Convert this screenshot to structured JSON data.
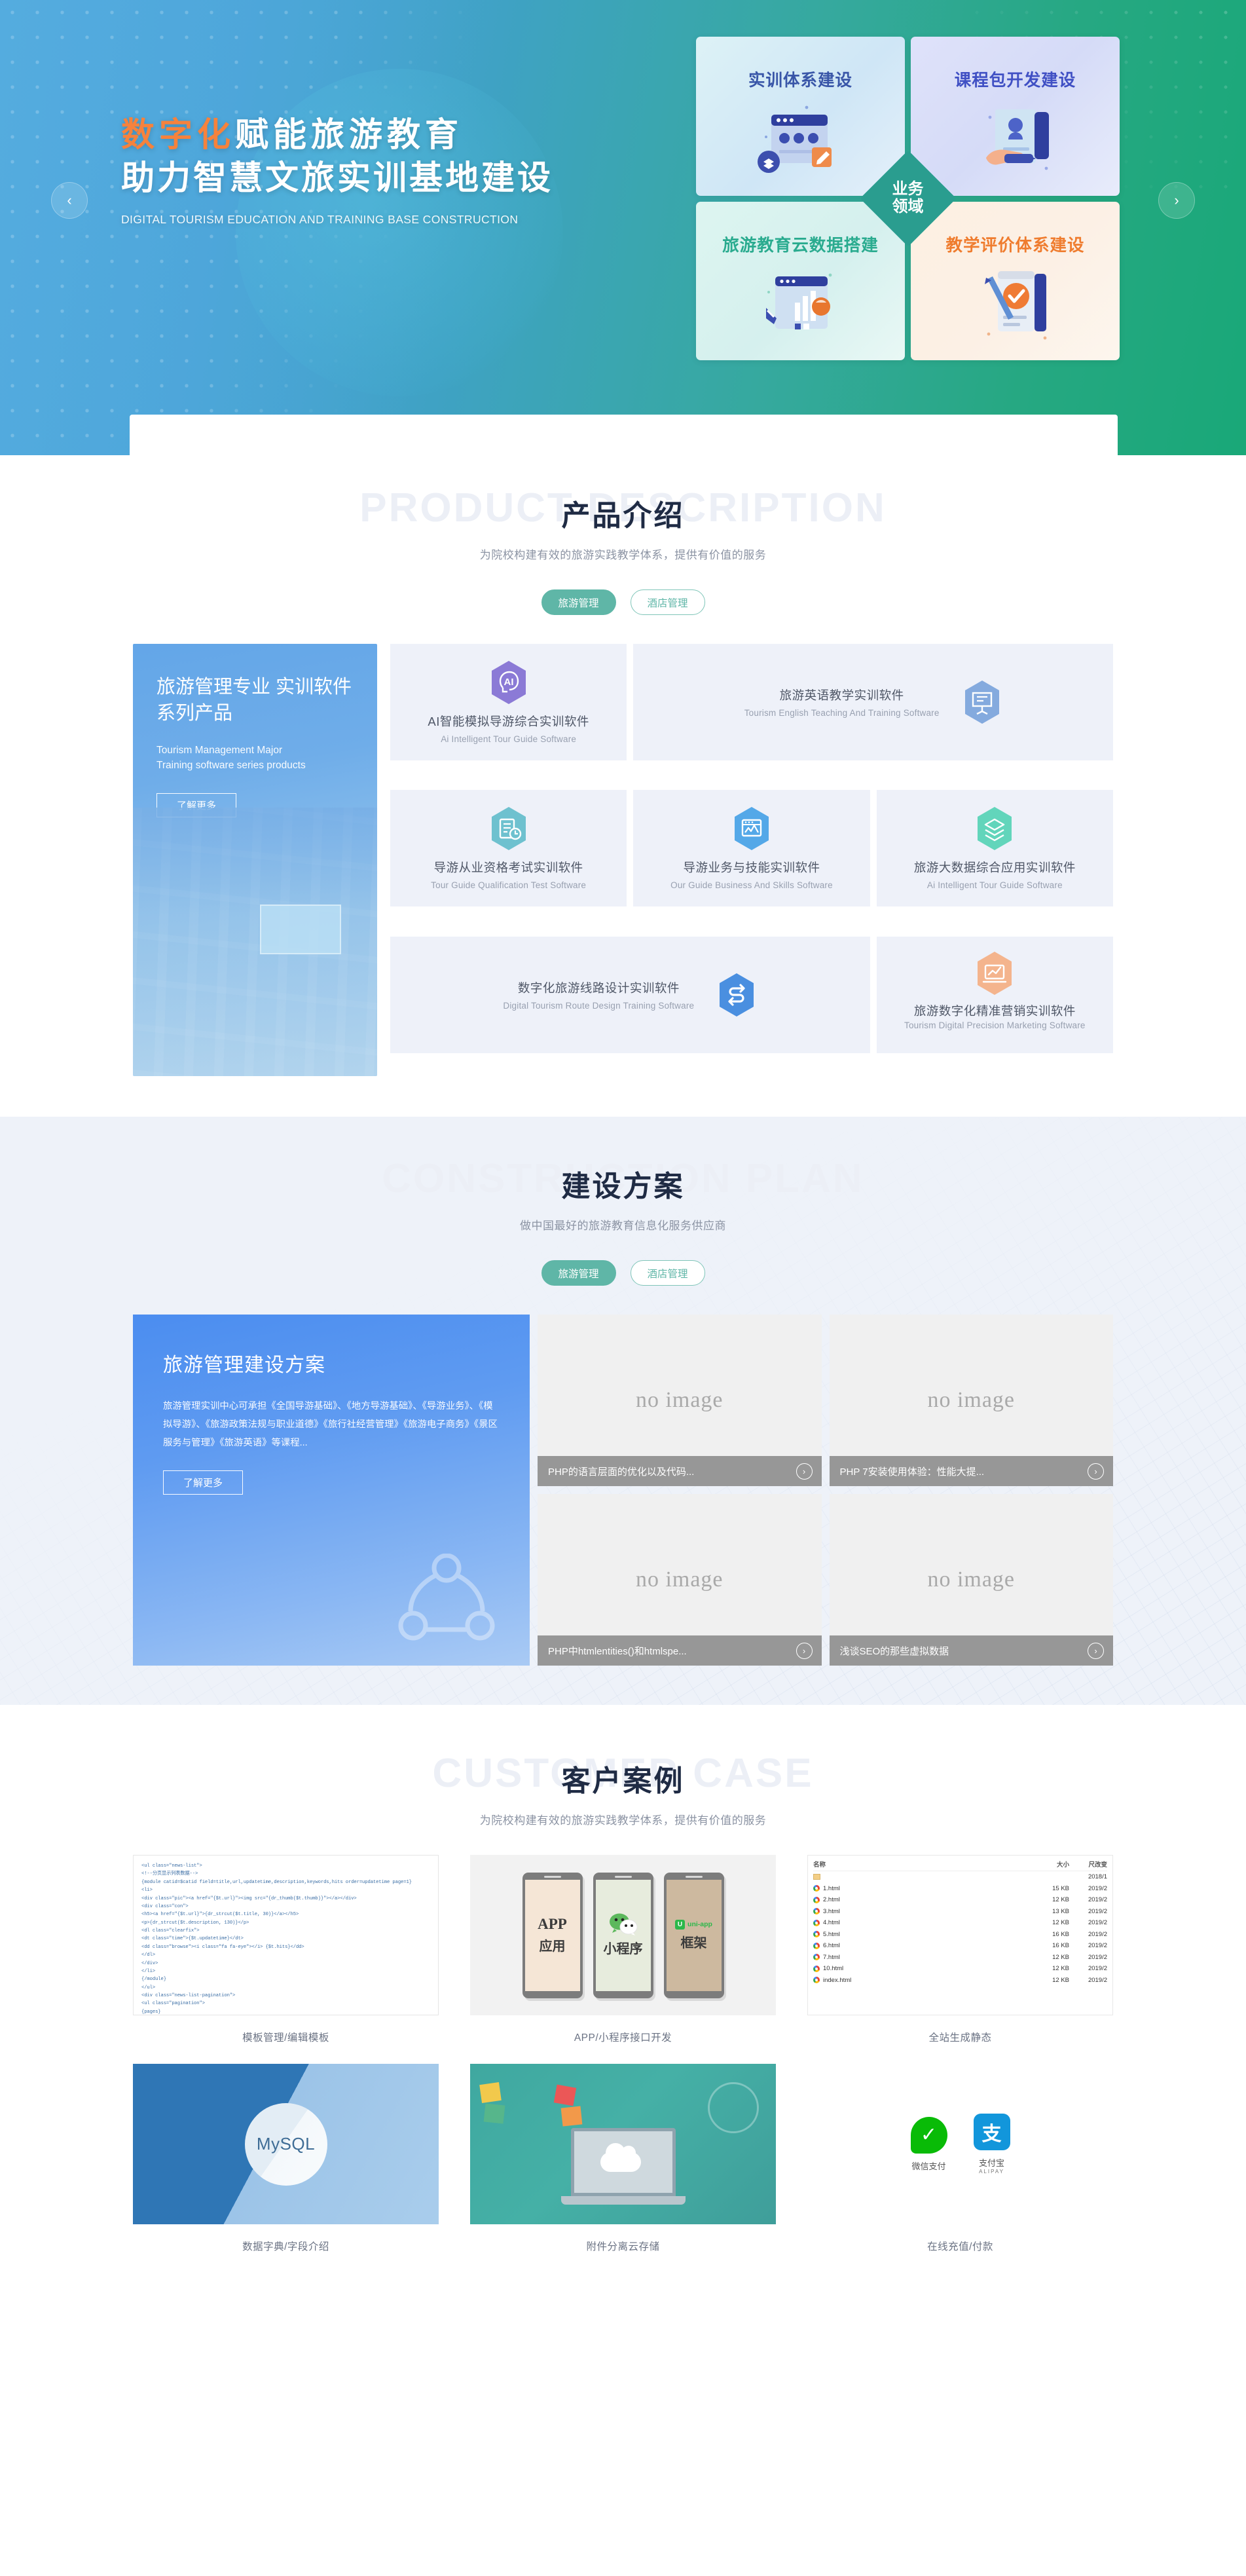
{
  "hero": {
    "title_accent": "数字化",
    "title_rest": "赋能旅游教育",
    "title_line2": "助力智慧文旅实训基地建设",
    "subtitle_en": "DIGITAL TOURISM EDUCATION AND TRAINING BASE CONSTRUCTION",
    "prev_arrow": "‹",
    "next_arrow": "›",
    "badge_line1": "业务",
    "badge_line2": "领域",
    "cards": [
      {
        "label": "实训体系建设"
      },
      {
        "label": "课程包开发建设"
      },
      {
        "label": "旅游教育云数据搭建"
      },
      {
        "label": "教学评价体系建设"
      }
    ]
  },
  "product_section": {
    "ghost": "PRODUCT DESCRIPTION",
    "title": "产品介绍",
    "subtitle": "为院校构建有效的旅游实践教学体系，提供有价值的服务",
    "tabs": [
      {
        "label": "旅游管理",
        "active": true
      },
      {
        "label": "酒店管理",
        "active": false
      }
    ],
    "promo": {
      "title": "旅游管理专业 实训软件系列产品",
      "en_line1": "Tourism Management Major",
      "en_line2": "Training software series products",
      "button": "了解更多"
    },
    "items": [
      {
        "cn": "AI智能模拟导游综合实训软件",
        "en": "Ai Intelligent Tour Guide Software",
        "icon": "ai-head-icon",
        "color": "#8b7ad6"
      },
      {
        "cn": "旅游英语教学实训软件",
        "en": "Tourism English Teaching And Training Software",
        "icon": "presentation-board-icon",
        "color": "#84aade"
      },
      {
        "cn": "导游从业资格考试实训软件",
        "en": "Tour Guide Qualification Test Software",
        "icon": "document-clock-icon",
        "color": "#6ec1cf"
      },
      {
        "cn": "导游业务与技能实训软件",
        "en": "Our Guide Business And Skills Software",
        "icon": "chart-window-icon",
        "color": "#54a8e8"
      },
      {
        "cn": "旅游大数据综合应用实训软件",
        "en": "Ai Intelligent Tour Guide Software",
        "icon": "layers-icon",
        "color": "#62d5bb"
      },
      {
        "cn": "数字化旅游线路设计实训软件",
        "en": "Digital Tourism Route Design Training Software",
        "icon": "s-arrow-icon",
        "color": "#4a8fe0"
      },
      {
        "cn": "旅游数字化精准营销实训软件",
        "en": "Tourism Digital Precision Marketing Software",
        "icon": "monitor-chart-icon",
        "color": "#f4b48d"
      }
    ]
  },
  "construction_section": {
    "ghost": "CONSTRUCTION PLAN",
    "title": "建设方案",
    "subtitle": "做中国最好的旅游教育信息化服务供应商",
    "tabs": [
      {
        "label": "旅游管理",
        "active": true
      },
      {
        "label": "酒店管理",
        "active": false
      }
    ],
    "promo": {
      "title": "旅游管理建设方案",
      "desc": "旅游管理实训中心可承担《全国导游基础》、《地方导游基础》、《导游业务》、《模拟导游》、《旅游政策法规与职业道德》《旅行社经营管理》《旅游电子商务》《景区服务与管理》《旅游英语》等课程...",
      "button": "了解更多"
    },
    "news": [
      {
        "placeholder": "no image",
        "title": "PHP的语言层面的优化以及代码...",
        "arrow": "›"
      },
      {
        "placeholder": "no image",
        "title": "PHP 7安装使用体验：性能大提...",
        "arrow": "›"
      },
      {
        "placeholder": "no image",
        "title": "PHP中htmlentities()和htmlspe...",
        "arrow": "›"
      },
      {
        "placeholder": "no image",
        "title": "浅谈SEO的那些虚拟数据",
        "arrow": "›"
      }
    ]
  },
  "cases_section": {
    "ghost": "CUSTOMER CASE",
    "title": "客户案例",
    "subtitle": "为院校构建有效的旅游实践教学体系，提供有价值的服务",
    "items": [
      {
        "caption": "模板管理/编辑模板",
        "media": "code-screenshot"
      },
      {
        "caption": "APP/小程序接口开发",
        "media": "phones"
      },
      {
        "caption": "全站生成静态",
        "media": "file-list"
      },
      {
        "caption": "数据字典/字段介绍",
        "media": "mysql"
      },
      {
        "caption": "附件分离云存储",
        "media": "cloud-laptop"
      },
      {
        "caption": "在线充值/付款",
        "media": "payments"
      }
    ],
    "code_lines": [
      "<ul class=\"news-list\">",
      "    <!--分页显示列表数据-->",
      "    {module catid=$catid field=title,url,updatetime,description,keywords,hits order=updatetime page=1}",
      "    <li>",
      "        <div class=\"pic\"><a href=\"{$t.url}\"><img src=\"{dr_thumb($t.thumb)}\"></a></div>",
      "        <div class=\"con\">",
      "            <h5><a href=\"{$t.url}\">{dr_strcut($t.title, 30)}</a></h5>",
      "            <p>{dr_strcut($t.description, 130)}</p>",
      "            <dl class=\"clearfix\">",
      "                <dt class=\"time\">{$t.updatetime}</dt>",
      "                <dd class=\"browse\"><i class=\"fa fa-eye\"></i> {$t.hits}</dd>",
      "            </dl>",
      "        </div>",
      "    </li>",
      "    {/module}",
      "</ul>",
      "<div class=\"news-list-pagination\">",
      "    <ul class=\"pagination\">",
      "        {pages}",
      "    </ul>",
      "</div>"
    ],
    "phones": [
      {
        "line1": "APP",
        "line2": "应用"
      },
      {
        "line1": "",
        "line2": "小程序",
        "logo": "wechat-icon"
      },
      {
        "line1": "uni-app",
        "line2": "框架",
        "logo": "uniapp-icon"
      }
    ],
    "file_list": {
      "columns": [
        "名称",
        "大小",
        "尺改变"
      ],
      "rows": [
        {
          "name": "",
          "size": "",
          "date": "2018/1",
          "icon": "folder-up-icon"
        },
        {
          "name": "1.html",
          "size": "15 KB",
          "date": "2019/2",
          "icon": "chrome-icon"
        },
        {
          "name": "2.html",
          "size": "12 KB",
          "date": "2019/2",
          "icon": "chrome-icon"
        },
        {
          "name": "3.html",
          "size": "13 KB",
          "date": "2019/2",
          "icon": "chrome-icon"
        },
        {
          "name": "4.html",
          "size": "12 KB",
          "date": "2019/2",
          "icon": "chrome-icon"
        },
        {
          "name": "5.html",
          "size": "16 KB",
          "date": "2019/2",
          "icon": "chrome-icon"
        },
        {
          "name": "6.html",
          "size": "16 KB",
          "date": "2019/2",
          "icon": "chrome-icon"
        },
        {
          "name": "7.html",
          "size": "12 KB",
          "date": "2019/2",
          "icon": "chrome-icon"
        },
        {
          "name": "10.html",
          "size": "12 KB",
          "date": "2019/2",
          "icon": "chrome-icon"
        },
        {
          "name": "index.html",
          "size": "12 KB",
          "date": "2019/2",
          "icon": "chrome-icon"
        }
      ]
    },
    "mysql_label": "MySQL",
    "payments": [
      {
        "label": "微信支付",
        "sub": ""
      },
      {
        "label": "支付宝",
        "sub": "ALIPAY"
      }
    ]
  },
  "colors": {
    "accent_orange": "#f6823c",
    "teal": "#5fb6a7",
    "hero_green": "#19a878",
    "hero_blue": "#4ea8dd",
    "section_bg": "#eef2f9",
    "card_bg": "#eef1f9"
  }
}
